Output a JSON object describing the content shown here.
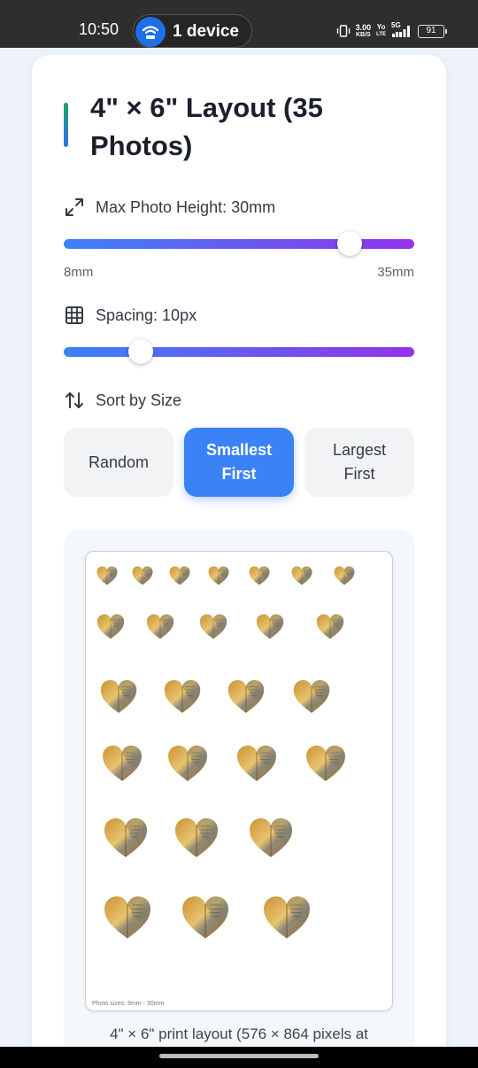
{
  "status_bar": {
    "time": "10:50",
    "device_label": "1 device",
    "speed": "3.00",
    "speed_unit": "KB/S",
    "volte_top": "Yo",
    "volte_bottom": "LTE",
    "network": "5G",
    "battery": "91"
  },
  "layout": {
    "title": "4\" × 6\" Layout (35 Photos)",
    "height_control": {
      "label": "Max Photo Height: 30mm",
      "min_label": "8mm",
      "max_label": "35mm",
      "value_mm": 30,
      "min_mm": 8,
      "max_mm": 35
    },
    "spacing_control": {
      "label": "Spacing: 10px",
      "value_fraction": 0.22
    },
    "sort": {
      "label": "Sort by Size",
      "options": [
        {
          "label": "Random",
          "active": false
        },
        {
          "label": "Smallest First",
          "active": true
        },
        {
          "label": "Largest First",
          "active": false
        }
      ]
    },
    "preview": {
      "sheet_note": "Photo sizes: 8mm - 30mm",
      "caption": "4\" × 6\" print layout (576 × 864 pixels at"
    }
  },
  "icons": [
    "wifi-icon",
    "vibrate-icon",
    "signal-icon",
    "battery-icon",
    "expand-icon",
    "grid-icon",
    "sort-icon",
    "heart-photo"
  ],
  "colors": {
    "accent_blue": "#3b82f6",
    "accent_purple": "#9333ea",
    "title_accent_top": "#1ea36a"
  }
}
